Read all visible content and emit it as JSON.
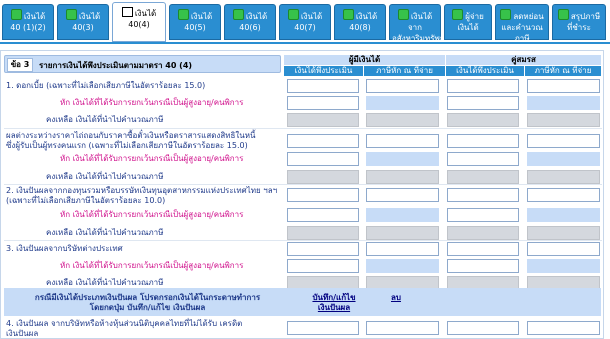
{
  "tabs": [
    {
      "label": "เงินได้ 40 (1)(2)",
      "icon": "green-page-icon",
      "active": false
    },
    {
      "label": "เงินได้ 40(3)",
      "icon": "green-page-icon",
      "active": false
    },
    {
      "label": "เงินได้ 40(4)",
      "icon": "open-book-icon",
      "active": true
    },
    {
      "label": "เงินได้ 40(5)",
      "icon": "green-page-icon",
      "active": false
    },
    {
      "label": "เงินได้ 40(6)",
      "icon": "green-page-icon",
      "active": false
    },
    {
      "label": "เงินได้ 40(7)",
      "icon": "green-page-icon",
      "active": false
    },
    {
      "label": "เงินได้ 40(8)",
      "icon": "green-page-icon",
      "active": false
    },
    {
      "label": "เงินได้จาก อสังหาริมทรัพย์",
      "icon": "green-page-icon",
      "active": false
    },
    {
      "label": "ผู้จ่าย เงินได้",
      "icon": "green-page-icon",
      "active": false
    },
    {
      "label": "ลดหย่อน และคำนวณ ภาษี",
      "icon": "green-page-icon",
      "active": false
    },
    {
      "label": "สรุปภาษี ที่ชำระ",
      "icon": "green-page-icon",
      "active": false
    }
  ],
  "section": {
    "number": "ข้อ 3",
    "title": "รายการเงินได้พึงประเมินตามมาตรา 40 (4)"
  },
  "columns": {
    "taxpayer": "ผู้มีเงินได้",
    "spouse": "คู่สมรส",
    "income": "เงินได้พึงประเมิน",
    "withheld": "ภาษีหัก ณ ที่จ่าย"
  },
  "rows": {
    "r1": "1. ดอกเบี้ย (เฉพาะที่ไม่เลือกเสียภาษีในอัตราร้อยละ 15.0)",
    "r1_exempt": "หัก เงินได้ที่ได้รับการยกเว้นกรณีเป็นผู้สูงอายุ/คนพิการ",
    "r1_bal": "คงเหลือ เงินได้ที่นำไปคำนวณภาษี",
    "r1b_a": "ผลต่างระหว่างราคาไถ่ถอนกับราคาซื้อตั๋วเงินหรือตราสารแสดงสิทธิในหนี้",
    "r1b_b": "ซึ่งผู้รับเป็นผู้ทรงคนแรก (เฉพาะที่ไม่เลือกเสียภาษีในอัตราร้อยละ 15.0)",
    "r1b_exempt": "หัก เงินได้ที่ได้รับการยกเว้นกรณีเป็นผู้สูงอายุ/คนพิการ",
    "r1b_bal": "คงเหลือ เงินได้ที่นำไปคำนวณภาษี",
    "r2_a": "2. เงินปันผลจากกองทุนรวมหรือบรรษัทเงินทุนอุตสาหกรรมแห่งประเทศไทย ฯลฯ",
    "r2_b": "(เฉพาะที่ไม่เลือกเสียภาษีในอัตราร้อยละ 10.0)",
    "r2_exempt": "หัก เงินได้ที่ได้รับการยกเว้นกรณีเป็นผู้สูงอายุ/คนพิการ",
    "r2_bal": "คงเหลือ เงินได้ที่นำไปคำนวณภาษี",
    "r3": "3. เงินปันผลจากบริษัทต่างประเทศ",
    "r3_exempt": "หัก เงินได้ที่ได้รับการยกเว้นกรณีเป็นผู้สูงอายุ/คนพิการ",
    "r3_bal": "คงเหลือ เงินได้ที่นำไปคำนวณภาษี",
    "r4_a": "4. เงินปันผล จากบริษัทหรือห้างหุ้นส่วนนิติบุคคลไทยที่ไม่ได้รับ เครดิต",
    "r4_b": "เงินปันผล"
  },
  "note": {
    "line1": "กรณีมีเงินได้ประเภทเงินปันผล โปรดกรอกเงินได้ในกระดาษทำการ",
    "line2": "โดยกดปุ่ม บันทึก/แก้ไข เงินปันผล",
    "save_a": "บันทึก/แก้ไข",
    "save_b": "เงินปันผล",
    "delete": "ลบ"
  },
  "colors": {
    "tab_bg": "#2a8ed1",
    "header_bg": "#c7dcf7",
    "pink_text": "#d0108c",
    "label_text": "#1f3a8a"
  }
}
